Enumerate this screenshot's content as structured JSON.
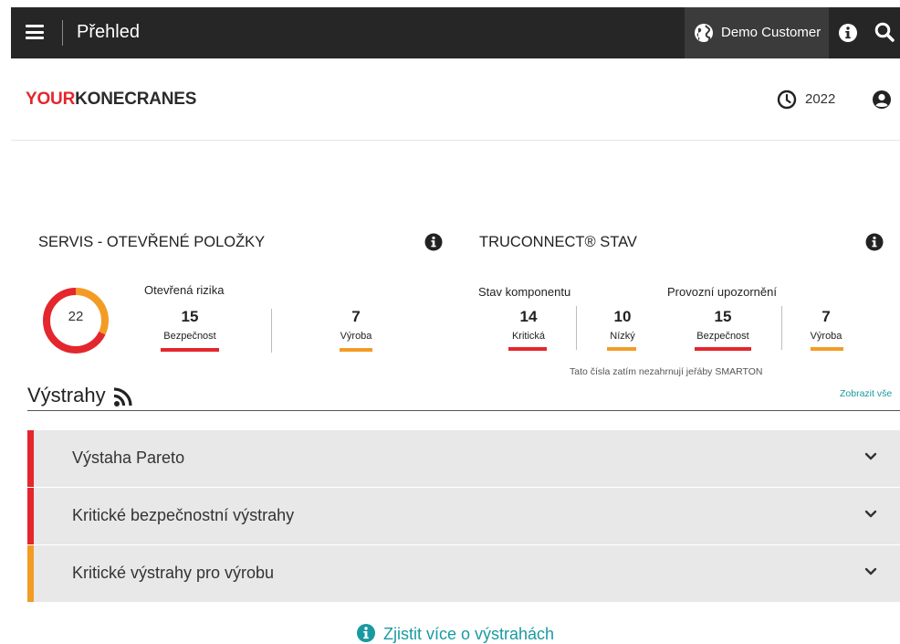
{
  "topbar": {
    "title": "Přehled",
    "customer": "Demo Customer"
  },
  "brand": {
    "part1": "YOUR",
    "part2": "KONECRANES",
    "color_red": "#e4262d"
  },
  "header_right": {
    "year": "2022"
  },
  "service": {
    "title": "SERVIS - OTEVŘENÉ POLOŽKY",
    "total": "22",
    "open_risks_label": "Otevřená rizika",
    "safety_value": "15",
    "safety_label": "Bezpečnost",
    "production_value": "7",
    "production_label": "Výroba",
    "donut_red_fraction": 0.68,
    "donut_orange_fraction": 0.32
  },
  "truconnect": {
    "title": "TRUCONNECT® STAV",
    "component_label": "Stav komponentu",
    "critical_value": "14",
    "critical_label": "Kritická",
    "low_value": "10",
    "low_label": "Nízký",
    "operational_label": "Provozní upozornění",
    "safety_value": "15",
    "safety_label": "Bezpečnost",
    "production_value": "7",
    "production_label": "Výroba",
    "note": "Tato čísla zatím nezahrnují jeřáby SMARTON"
  },
  "alerts": {
    "title": "Výstrahy",
    "show_all": "Zobrazit vše",
    "items": [
      {
        "label": "Výstaha Pareto",
        "color": "#e4262d"
      },
      {
        "label": "Kritické bezpečnostní výstrahy",
        "color": "#e4262d"
      },
      {
        "label": "Kritické výstrahy pro výrobu",
        "color": "#f39c25"
      }
    ],
    "learn_more": "Zjistit více o výstrahách"
  },
  "icons": [
    "hamburger-icon",
    "globe-icon",
    "info-icon",
    "search-icon",
    "clock-icon",
    "user-icon",
    "rss-icon",
    "chevron-down-icon"
  ],
  "colors": {
    "red": "#e4262d",
    "orange": "#f39c25",
    "teal": "#1a9aa0",
    "topbar": "#262626"
  }
}
